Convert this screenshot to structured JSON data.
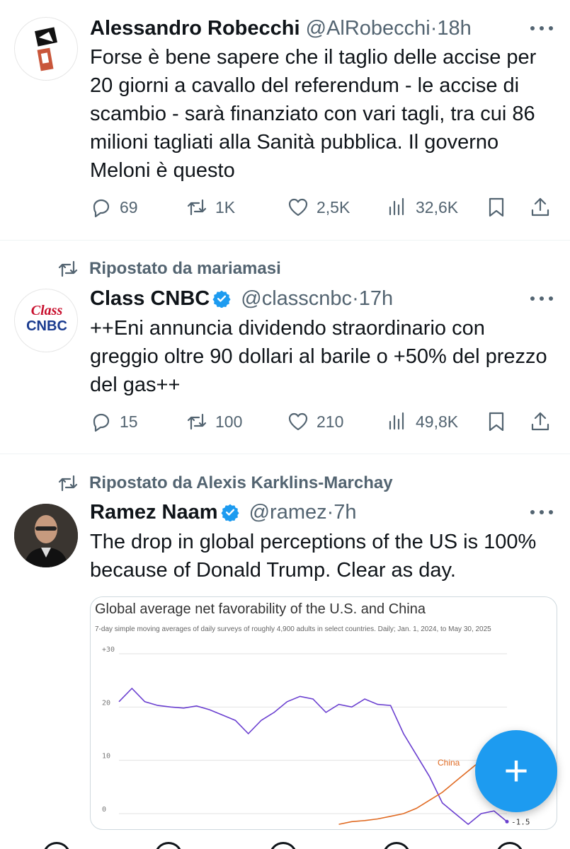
{
  "tweets": [
    {
      "name": "Alessandro Robecchi",
      "handle": "@AlRobecchi",
      "time": "18h",
      "text": "Forse è bene sapere che il taglio delle accise per 20 giorni a cavallo del referendum - le accise di scambio - sarà finanziato con vari tagli, tra cui 86 milioni tagliati alla Sanità pubblica. Il governo Meloni è questo",
      "replies": "69",
      "reposts": "1K",
      "likes": "2,5K",
      "views": "32,6K"
    },
    {
      "reposted_by": "Ripostato da mariamasi",
      "name": "Class CNBC",
      "handle": "@classcnbc",
      "time": "17h",
      "avatar_text_top": "Class",
      "avatar_text_bottom": "CNBC",
      "text": "++Eni annuncia dividendo straordinario con greggio oltre 90 dollari al barile o +50% del prezzo del gas++",
      "replies": "15",
      "reposts": "100",
      "likes": "210",
      "views": "49,8K"
    },
    {
      "reposted_by": "Ripostato da Alexis Karklins-Marchay",
      "name": "Ramez Naam",
      "handle": "@ramez",
      "time": "7h",
      "text": "The drop in global perceptions of the US is 100% because of Donald Trump. Clear as day."
    }
  ],
  "chart_data": {
    "type": "line",
    "title": "Global average net favorability of the U.S. and China",
    "subtitle": "7-day simple moving averages of daily surveys of roughly 4,900 adults in select countries. Daily; Jan. 1, 2024, to May 30, 2025",
    "yticks": [
      "+30",
      "20",
      "10",
      "0"
    ],
    "ylim": [
      -2,
      30
    ],
    "series": [
      {
        "name": "",
        "color": "#6a3fd0",
        "values": [
          21,
          23.5,
          21,
          20.3,
          20,
          19.8,
          20.2,
          19.5,
          18.5,
          17.5,
          15,
          17.5,
          19,
          21,
          22,
          21.5,
          19,
          20.5,
          20,
          21.5,
          20.5,
          20.3,
          15,
          11,
          7,
          2,
          0,
          -2,
          0,
          0.5,
          -1.5
        ],
        "end_label": "-1.5"
      },
      {
        "name": "China",
        "color": "#e06a22",
        "values": [
          null,
          null,
          null,
          null,
          null,
          null,
          null,
          null,
          null,
          null,
          null,
          null,
          null,
          null,
          null,
          null,
          null,
          -2,
          -1.5,
          -1.3,
          -1,
          -0.5,
          0,
          1,
          2.5,
          4,
          6,
          8,
          10,
          null,
          null
        ]
      }
    ],
    "china_label": "China"
  },
  "fab_label": "+",
  "colors": {
    "accent": "#1d9bf0",
    "text": "#0f1419",
    "muted": "#536471",
    "us_line": "#6a3fd0",
    "china_line": "#e06a22"
  }
}
